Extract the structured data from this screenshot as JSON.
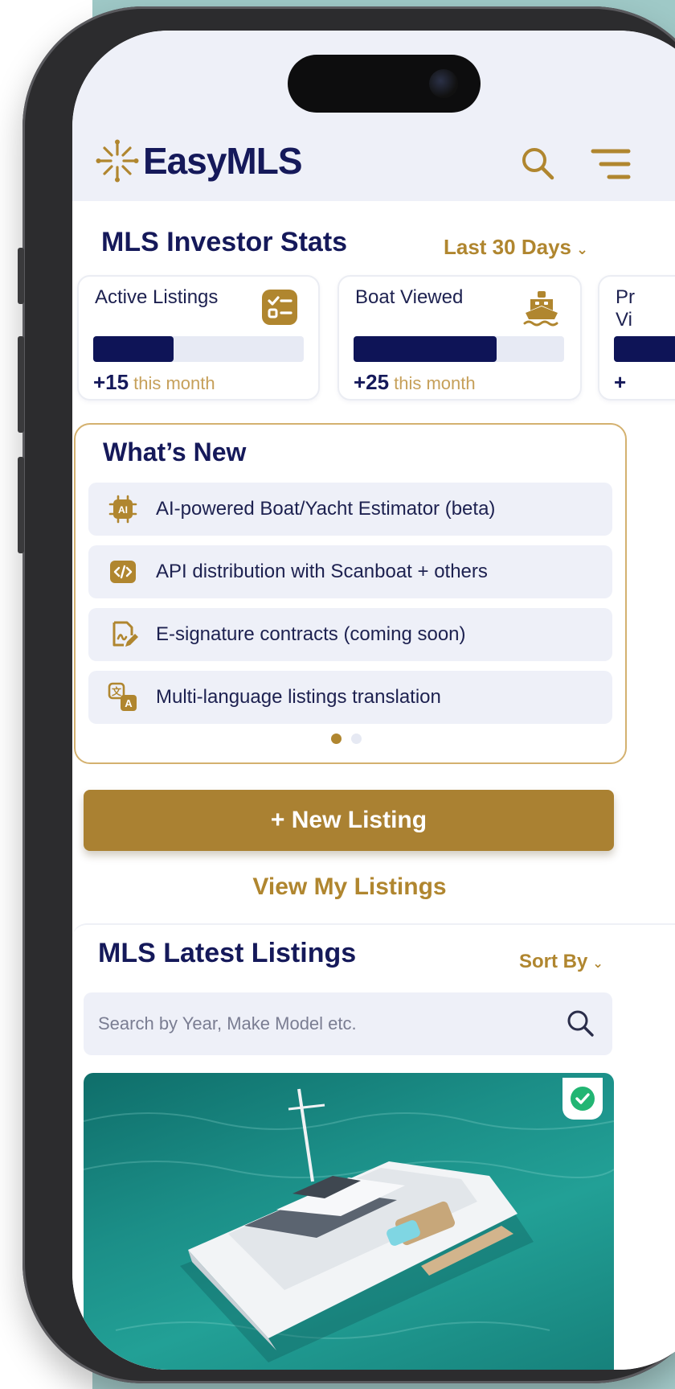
{
  "brand": {
    "name": "EasyMLS"
  },
  "stats": {
    "title": "MLS Investor Stats",
    "period": "Last 30 Days",
    "cards": [
      {
        "label": "Active Listings",
        "delta": "+15",
        "suffix": "this month",
        "progress": 0.38
      },
      {
        "label": "Boat Viewed",
        "delta": "+25",
        "suffix": "this month",
        "progress": 0.68
      },
      {
        "label": "Pr Vi",
        "delta": "+",
        "suffix": "",
        "progress": 0.5
      }
    ]
  },
  "whats_new": {
    "title": "What’s New",
    "items": [
      {
        "label": "AI-powered Boat/Yacht Estimator (beta)",
        "icon": "ai-chip-icon"
      },
      {
        "label": "API distribution with Scanboat + others",
        "icon": "code-icon"
      },
      {
        "label": "E-signature contracts (coming soon)",
        "icon": "signature-icon"
      },
      {
        "label": "Multi-language listings translation",
        "icon": "translate-icon"
      }
    ],
    "page_index": 1,
    "page_count": 2
  },
  "actions": {
    "new_listing": "+ New Listing",
    "view_listings": "View My Listings"
  },
  "latest": {
    "title": "MLS Latest Listings",
    "sort_label": "Sort By",
    "search_placeholder": "Search by Year, Make Model etc."
  },
  "colors": {
    "navy": "#15195a",
    "gold": "#aa8132",
    "panel": "#eef0f8",
    "verified": "#22b573"
  }
}
